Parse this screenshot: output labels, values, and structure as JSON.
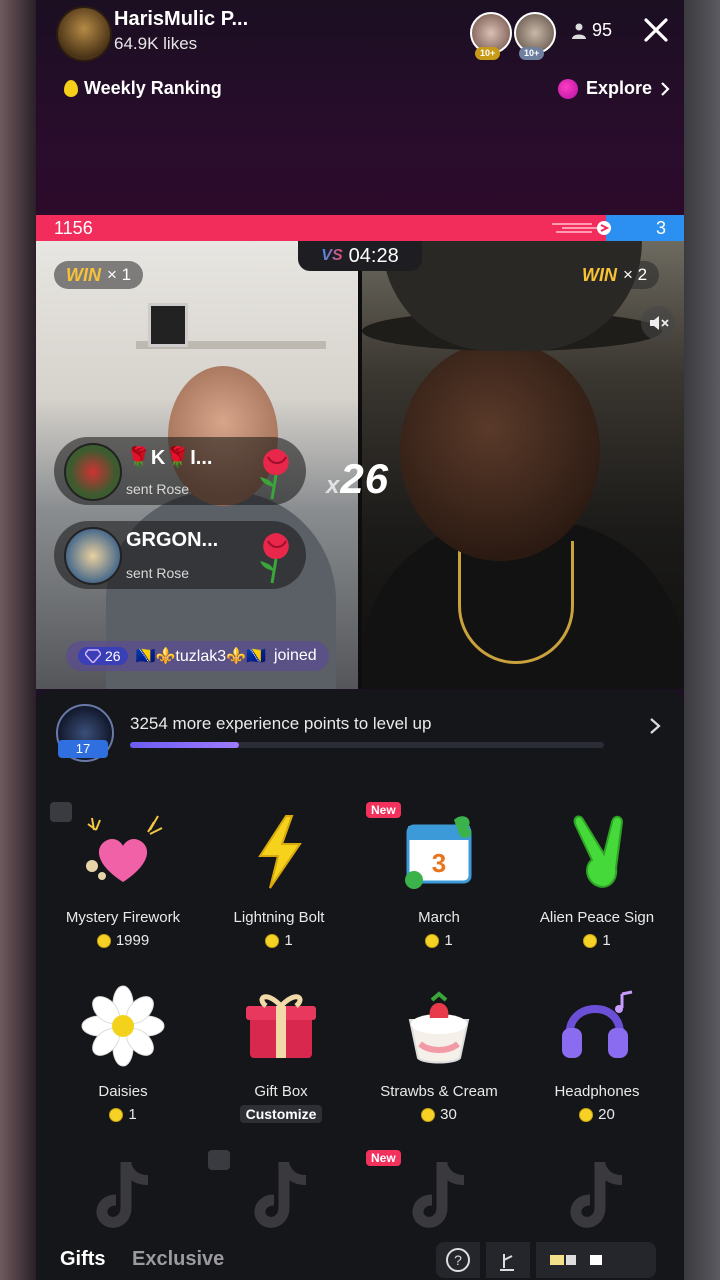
{
  "host": {
    "name": "HarisMulic P...",
    "likes": "64.9K likes"
  },
  "viewers": {
    "badge1": "10+",
    "badge2": "10+",
    "count": "95"
  },
  "header": {
    "ranking": "Weekly Ranking",
    "explore": "Explore"
  },
  "battle": {
    "score_left": "1156",
    "score_right": "3",
    "timer": "04:28",
    "vs_label": "VS",
    "win_left_label": "WIN",
    "win_left_count": "× 1",
    "win_right_label": "WIN",
    "win_right_count": "× 2",
    "multiplier_prefix": "x",
    "multiplier": "26"
  },
  "gift_feed": [
    {
      "name": "🌹K🌹I...",
      "sub": "sent Rose"
    },
    {
      "name": "GRGON...",
      "sub": "sent Rose"
    }
  ],
  "join_notice": {
    "gem_count": "26",
    "user": "🇧🇦⚜️tuzlak3⚜️🇧🇦",
    "action": "joined"
  },
  "level": {
    "text": "3254 more experience points to level up",
    "level": "17",
    "progress": 0.23
  },
  "gifts": [
    {
      "name": "Mystery Firework",
      "price": "1999"
    },
    {
      "name": "Lightning Bolt",
      "price": "1"
    },
    {
      "name": "March",
      "price": "1",
      "badge": "New"
    },
    {
      "name": "Alien Peace Sign",
      "price": "1"
    },
    {
      "name": "Daisies",
      "price": "1"
    },
    {
      "name": "Gift Box",
      "action": "Customize"
    },
    {
      "name": "Strawbs & Cream",
      "price": "30"
    },
    {
      "name": "Headphones",
      "price": "20"
    }
  ],
  "row3_badge": "New",
  "tabs": {
    "gifts": "Gifts",
    "exclusive": "Exclusive"
  },
  "colors": {
    "pink": "#f22d5c",
    "blue": "#2c8ff2",
    "coin": "#f6d227",
    "panel": "#151619"
  }
}
